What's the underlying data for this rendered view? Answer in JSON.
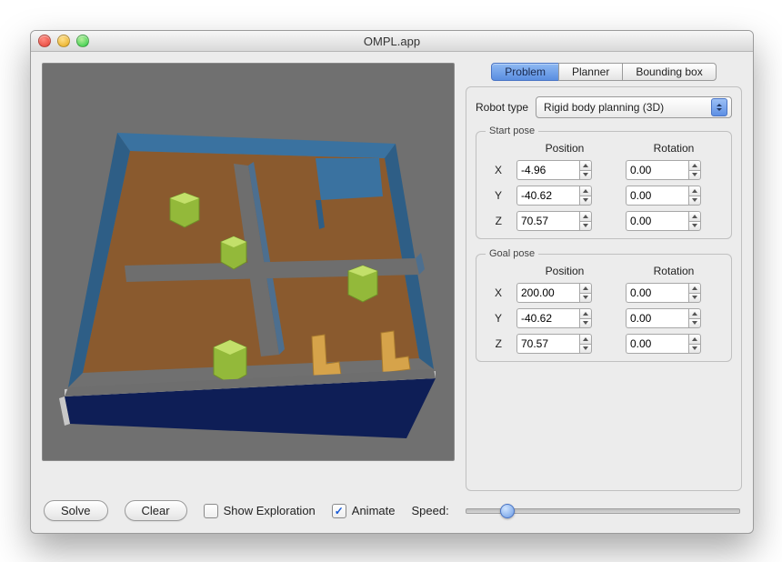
{
  "window": {
    "title": "OMPL.app"
  },
  "tabs": [
    "Problem",
    "Planner",
    "Bounding box"
  ],
  "active_tab": "Problem",
  "panel": {
    "robot_type_label": "Robot type",
    "robot_type_value": "Rigid body planning (3D)",
    "headers": {
      "position": "Position",
      "rotation": "Rotation"
    },
    "axes": [
      "X",
      "Y",
      "Z"
    ],
    "start": {
      "legend": "Start pose",
      "position": {
        "x": "-4.96",
        "y": "-40.62",
        "z": "70.57"
      },
      "rotation": {
        "x": "0.00",
        "y": "0.00",
        "z": "0.00"
      }
    },
    "goal": {
      "legend": "Goal pose",
      "position": {
        "x": "200.00",
        "y": "-40.62",
        "z": "70.57"
      },
      "rotation": {
        "x": "0.00",
        "y": "0.00",
        "z": "0.00"
      }
    }
  },
  "toolbar": {
    "solve": "Solve",
    "clear": "Clear",
    "show_exploration": "Show Exploration",
    "show_exploration_checked": false,
    "animate": "Animate",
    "animate_checked": true,
    "speed_label": "Speed:",
    "speed_value": 0.15
  },
  "colors": {
    "accent": "#5d8fe4",
    "floor": "#8a5a2e",
    "wall": "#3a72a0",
    "column": "#93b93a",
    "robot": "#d6a34a"
  }
}
